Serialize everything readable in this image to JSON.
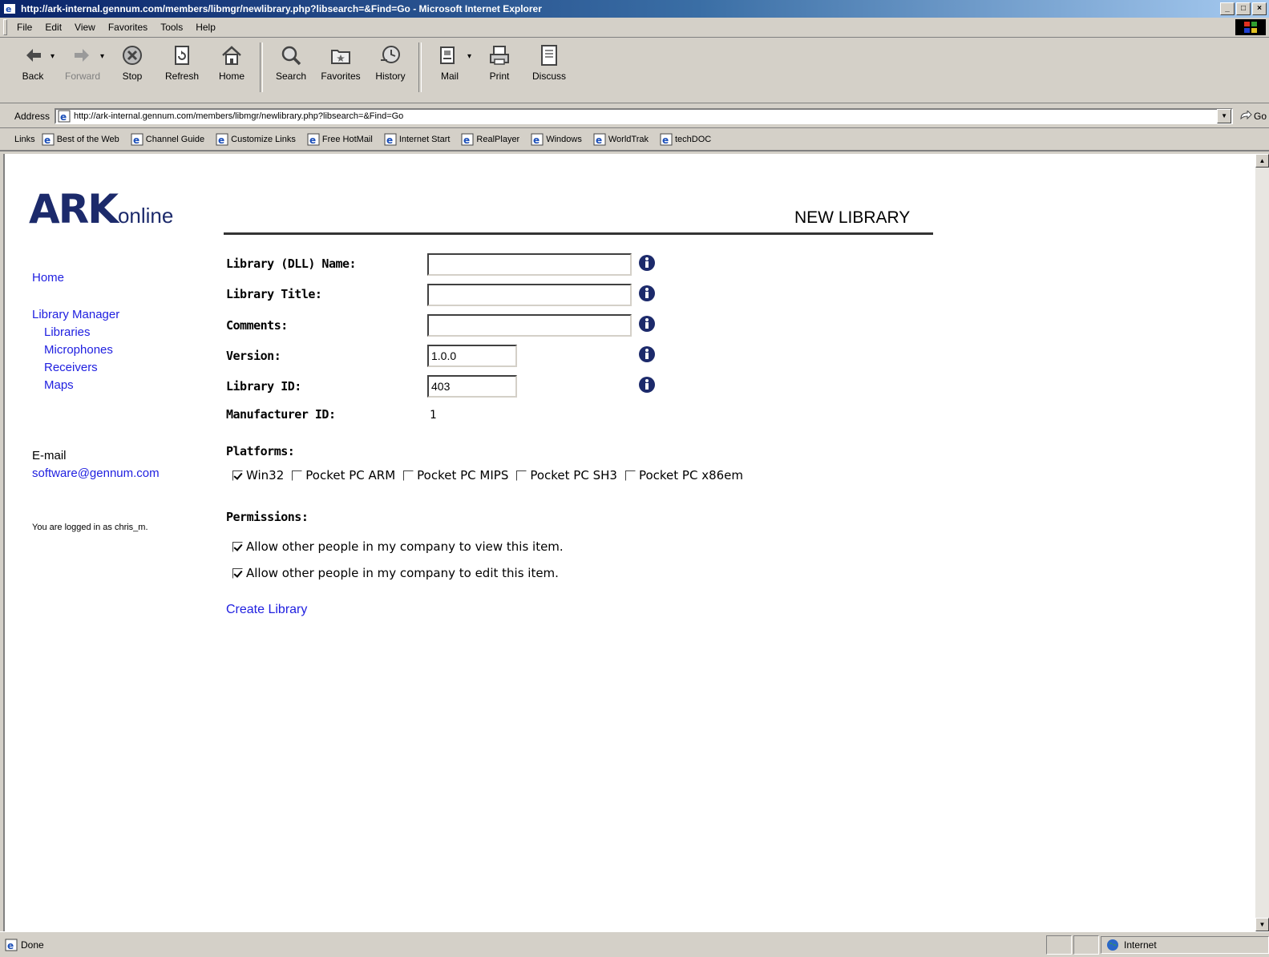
{
  "window": {
    "title": "http://ark-internal.gennum.com/members/libmgr/newlibrary.php?libsearch=&Find=Go - Microsoft Internet Explorer"
  },
  "menu": [
    "File",
    "Edit",
    "View",
    "Favorites",
    "Tools",
    "Help"
  ],
  "toolbar": {
    "back": "Back",
    "forward": "Forward",
    "stop": "Stop",
    "refresh": "Refresh",
    "home": "Home",
    "search": "Search",
    "favorites": "Favorites",
    "history": "History",
    "mail": "Mail",
    "print": "Print",
    "discuss": "Discuss"
  },
  "address": {
    "label": "Address",
    "url": "http://ark-internal.gennum.com/members/libmgr/newlibrary.php?libsearch=&Find=Go",
    "go": "Go"
  },
  "links": {
    "label": "Links",
    "items": [
      "Best of the Web",
      "Channel Guide",
      "Customize Links",
      "Free HotMail",
      "Internet Start",
      "RealPlayer",
      "Windows",
      "WorldTrak",
      "techDOC"
    ]
  },
  "page": {
    "logo_main": "ARK",
    "logo_sub": "online",
    "title": "NEW LIBRARY",
    "nav": {
      "home": "Home",
      "library_manager": "Library Manager",
      "libraries": "Libraries",
      "microphones": "Microphones",
      "receivers": "Receivers",
      "maps": "Maps"
    },
    "email_label": "E-mail",
    "email": "software@gennum.com",
    "logged_in": "You are logged in as chris_m.",
    "form": {
      "dll_name_label": "Library (DLL) Name:",
      "dll_name_value": "",
      "title_label": "Library Title:",
      "title_value": "",
      "comments_label": "Comments:",
      "comments_value": "",
      "version_label": "Version:",
      "version_value": "1.0.0",
      "library_id_label": "Library ID:",
      "library_id_value": "403",
      "manufacturer_label": "Manufacturer ID:",
      "manufacturer_value": "1"
    },
    "platforms": {
      "heading": "Platforms:",
      "items": [
        {
          "label": "Win32",
          "checked": true
        },
        {
          "label": "Pocket PC ARM",
          "checked": false
        },
        {
          "label": "Pocket PC MIPS",
          "checked": false
        },
        {
          "label": "Pocket PC SH3",
          "checked": false
        },
        {
          "label": "Pocket PC x86em",
          "checked": false
        }
      ]
    },
    "permissions": {
      "heading": "Permissions:",
      "view": "Allow other people in my company to view this item.",
      "view_checked": true,
      "edit": "Allow other people in my company to edit this item.",
      "edit_checked": true
    },
    "create": "Create Library"
  },
  "status": {
    "text": "Done",
    "zone": "Internet"
  },
  "colors": {
    "link": "#2020e0",
    "logo": "#1c2a6b",
    "info_icon": "#1c2a6b",
    "title_bar": "#0a246a"
  }
}
